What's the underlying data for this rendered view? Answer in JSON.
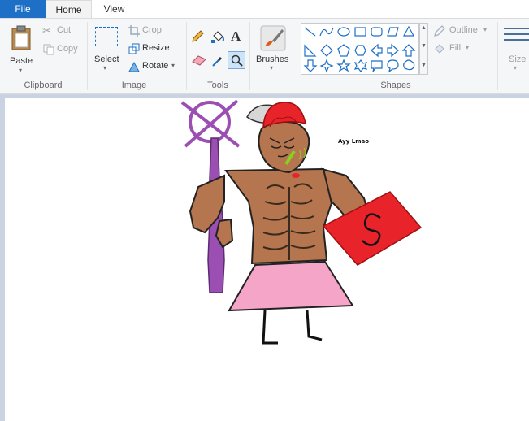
{
  "tabs": {
    "file": "File",
    "home": "Home",
    "view": "View"
  },
  "clipboard": {
    "paste": "Paste",
    "cut": "Cut",
    "copy": "Copy",
    "label": "Clipboard"
  },
  "image": {
    "select": "Select",
    "crop": "Crop",
    "resize": "Resize",
    "rotate": "Rotate",
    "label": "Image"
  },
  "tools": {
    "label": "Tools"
  },
  "brushes": {
    "label": "Brushes"
  },
  "shapes": {
    "label": "Shapes",
    "outline": "Outline",
    "fill": "Fill"
  },
  "size": {
    "label": "Size"
  },
  "canvas": {
    "annotation": "Ayy Lmao"
  },
  "colors": {
    "accent": "#1e6fc6",
    "purple": "#9b4fb3",
    "red": "#e8232a",
    "skin": "#b5764f",
    "pink": "#f5a6c8"
  }
}
